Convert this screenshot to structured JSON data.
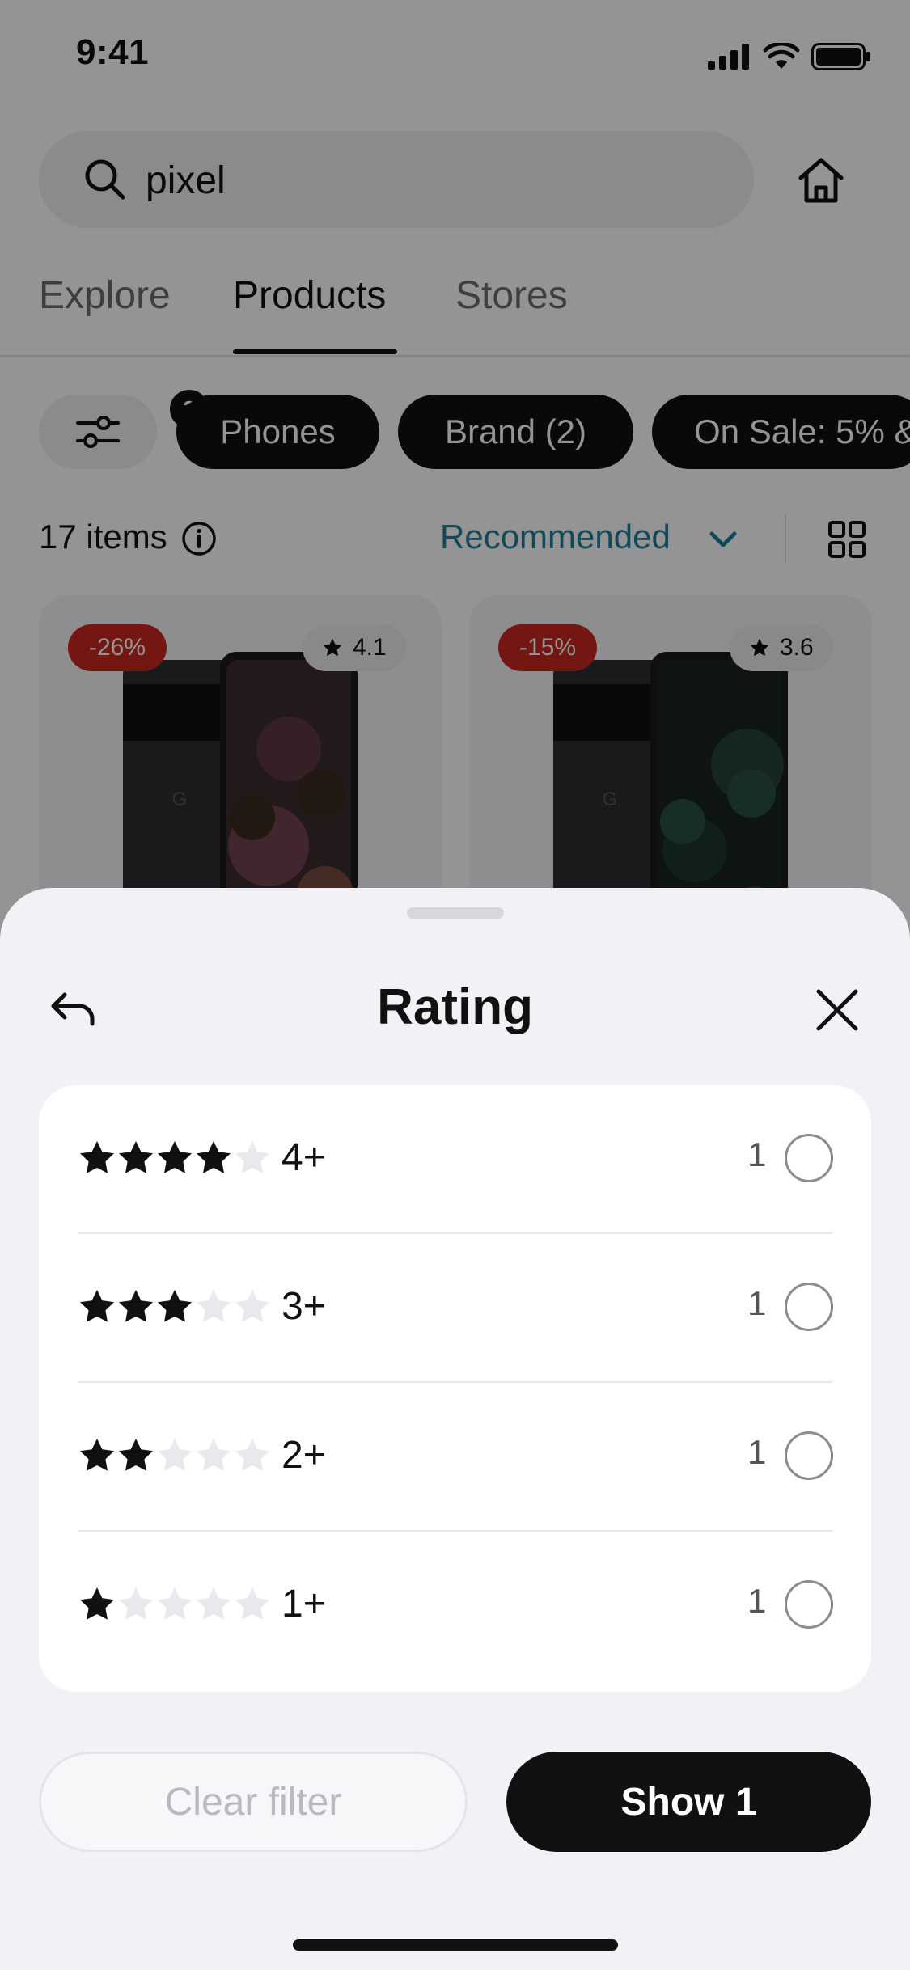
{
  "status_bar": {
    "time": "9:41"
  },
  "search": {
    "query": "pixel"
  },
  "tabs": [
    {
      "label": "Explore"
    },
    {
      "label": "Products"
    },
    {
      "label": "Stores"
    }
  ],
  "active_tab": "Products",
  "filters": {
    "badge_count": "3",
    "chips": [
      {
        "label": "Phones"
      },
      {
        "label": "Brand (2)"
      },
      {
        "label": "On Sale: 5% &"
      }
    ]
  },
  "results": {
    "count_label": "17 items",
    "sort_label": "Recommended"
  },
  "products": [
    {
      "discount": "-26%",
      "rating": "4.1"
    },
    {
      "discount": "-15%",
      "rating": "3.6"
    }
  ],
  "sheet": {
    "title": "Rating",
    "options": [
      {
        "label": "4+",
        "count": "1",
        "filled_stars": 4,
        "selected": false
      },
      {
        "label": "3+",
        "count": "1",
        "filled_stars": 3,
        "selected": false
      },
      {
        "label": "2+",
        "count": "1",
        "filled_stars": 2,
        "selected": false
      },
      {
        "label": "1+",
        "count": "1",
        "filled_stars": 1,
        "selected": false
      }
    ],
    "clear_label": "Clear filter",
    "show_label": "Show 1"
  },
  "colors": {
    "accent_link": "#1f7f9a",
    "discount_red": "#c8261e",
    "primary_button": "#111111",
    "sheet_background": "#f1f1f6"
  },
  "icons": {
    "search": "search-icon",
    "home": "home-icon",
    "filter": "sliders-icon",
    "info": "info-icon",
    "sort": "chevron-down-icon",
    "view": "grid-view-icon",
    "back": "back-arrow-icon",
    "close": "close-icon",
    "star": "star-icon"
  }
}
